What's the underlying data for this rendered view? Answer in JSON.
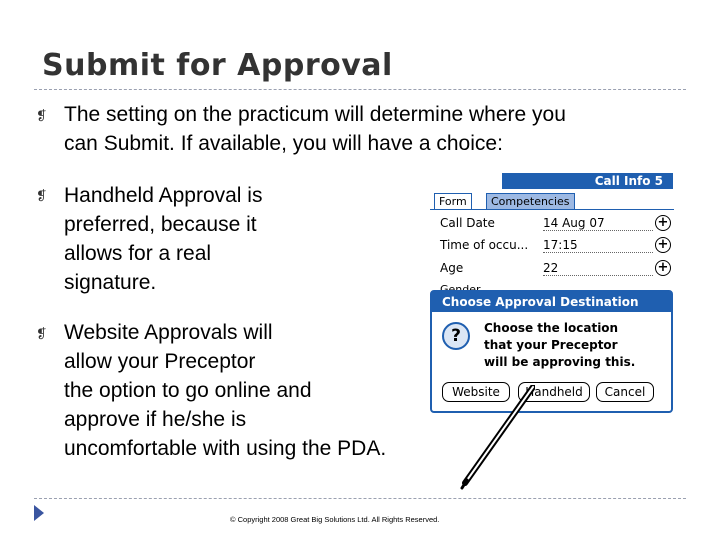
{
  "slide": {
    "title": "Submit for Approval",
    "bullets": [
      {
        "lines": [
          "The setting on the practicum will determine where you",
          "can Submit.  If available, you will have a choice:"
        ]
      },
      {
        "lines": [
          "Handheld Approval is",
          "preferred, because it",
          "allows for a real",
          "signature."
        ]
      },
      {
        "lines": [
          "Website Approvals will",
          "allow your Preceptor",
          "the option to go online and",
          "approve if he/she is",
          "uncomfortable with using the PDA."
        ]
      }
    ],
    "bullet_glyph": "❡",
    "footer": "© Copyright 2008  Great Big Solutions Ltd. All Rights Reserved."
  },
  "pda": {
    "title": "Call Info 5",
    "tabs": [
      "Form",
      "Competencies"
    ],
    "rows": [
      {
        "label": "Call Date",
        "value": "14 Aug 07"
      },
      {
        "label": "Time of occu...",
        "value": "17:15"
      },
      {
        "label": "Age",
        "value": "22"
      }
    ],
    "gender_label": "Gender",
    "plus_glyph": "+",
    "dialog": {
      "title": "Choose Approval Destination",
      "icon_glyph": "?",
      "message": [
        "Choose the location",
        "that your Preceptor",
        "will be approving this."
      ],
      "buttons": [
        "Website",
        "Handheld",
        "Cancel"
      ]
    }
  },
  "colors": {
    "accent": "#1f5fb0",
    "triangle": "#3a55a0"
  }
}
